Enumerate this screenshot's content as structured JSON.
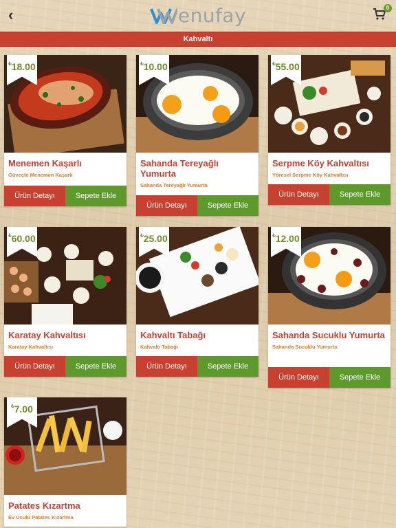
{
  "header": {
    "back_icon": "back-arrow-icon",
    "logo_text": "enufay",
    "cart_icon": "cart-icon",
    "cart_count": "0",
    "colors": {
      "logo_blue": "#2a8fd6",
      "logo_gray": "#9aa4a8"
    }
  },
  "category": {
    "title": "Kahvaltı",
    "color": "#c8402f"
  },
  "buttons": {
    "detail": "Ürün Detayı",
    "add": "Sepete Ekle"
  },
  "currency_symbol": "₺",
  "products": [
    {
      "price": "18.00",
      "title": "Menemen Kaşarlı",
      "subtitle": "Güveçte Menemen Kaşarlı"
    },
    {
      "price": "10.00",
      "title": "Sahanda Tereyağlı Yumurta",
      "subtitle": "Sahanda Tereyağlı Yumurta"
    },
    {
      "price": "55.00",
      "title": "Serpme Köy Kahvaltısı",
      "subtitle": "Yöresel Serpme Köy Kahvaltısı"
    },
    {
      "price": "60.00",
      "title": "Karatay Kahvaltısı",
      "subtitle": "Karatay Kahvaltısı"
    },
    {
      "price": "25.00",
      "title": "Kahvaltı Tabağı",
      "subtitle": "Kahvaltı Tabağı"
    },
    {
      "price": "12.00",
      "title": "Sahanda Sucuklu Yumurta",
      "subtitle": "Sahanda Sucuklu Yumurta"
    },
    {
      "price": "7.00",
      "title": "Patates Kızartma",
      "subtitle": "Ev Usulü Patates Kızartma"
    }
  ]
}
